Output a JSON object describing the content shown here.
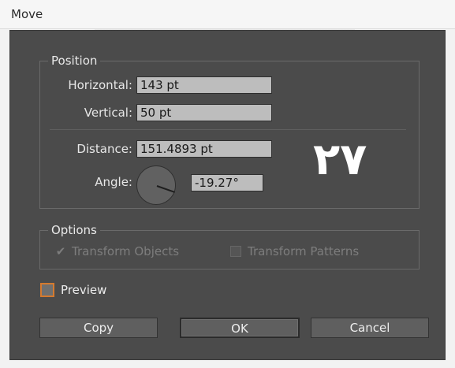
{
  "window": {
    "title": "Move"
  },
  "position": {
    "legend": "Position",
    "horizontal_label": "Horizontal:",
    "horizontal_value": "143 pt",
    "vertical_label": "Vertical:",
    "vertical_value": "50 pt",
    "distance_label": "Distance:",
    "distance_value": "151.4893 pt",
    "angle_label": "Angle:",
    "angle_value": "-19.27°"
  },
  "overlay": {
    "text": "٢٧"
  },
  "options": {
    "legend": "Options",
    "transform_objects": "Transform Objects",
    "transform_patterns": "Transform Patterns"
  },
  "preview": {
    "label": "Preview"
  },
  "buttons": {
    "copy": "Copy",
    "ok": "OK",
    "cancel": "Cancel"
  },
  "colors": {
    "dialog_background": "#4b4b4b",
    "field_background": "#bdbdbd",
    "preview_accent": "#d47a2f"
  }
}
